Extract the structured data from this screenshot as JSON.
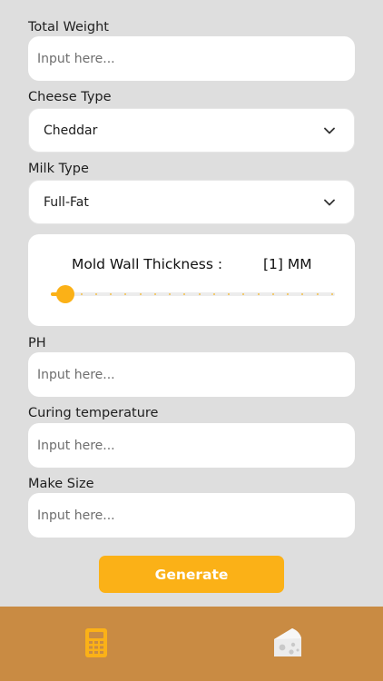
{
  "form": {
    "total_weight": {
      "label": "Total Weight",
      "placeholder": "Input here..."
    },
    "cheese_type": {
      "label": "Cheese Type",
      "value": "Cheddar"
    },
    "milk_type": {
      "label": "Milk Type",
      "value": "Full-Fat"
    },
    "mold_wall": {
      "title": "Mold Wall Thickness :",
      "value_text": "[1] MM",
      "slider_fraction": 0.05
    },
    "ph": {
      "label": "PH",
      "placeholder": "Input here..."
    },
    "curing_temperature": {
      "label": "Curing temperature",
      "placeholder": "Input here..."
    },
    "make_size": {
      "label": "Make Size",
      "placeholder": "Input here..."
    }
  },
  "generate_label": "Generate",
  "tabbar": {
    "tabs": [
      {
        "icon": "calculator-icon",
        "active": true
      },
      {
        "icon": "cheese-icon",
        "active": false
      }
    ]
  },
  "colors": {
    "accent": "#fbb117",
    "tabbar": "#c98b43",
    "background": "#dedede"
  }
}
